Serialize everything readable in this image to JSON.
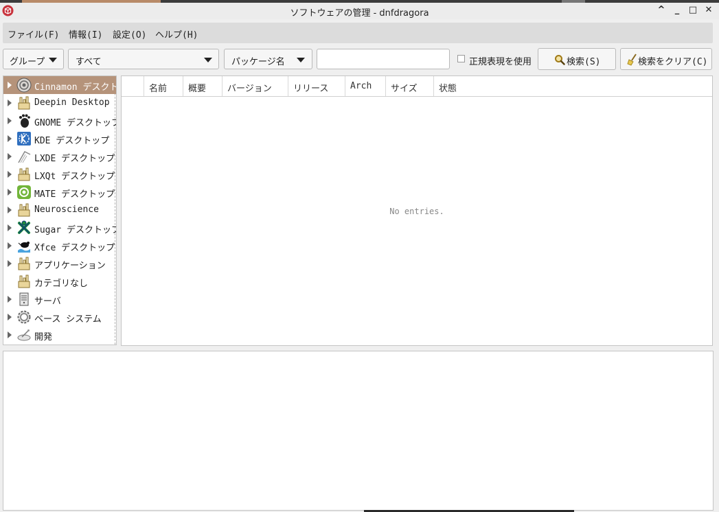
{
  "window": {
    "title": "ソフトウェアの管理 - dnfdragora",
    "buttons": [
      "^",
      "_",
      "□",
      "✕"
    ]
  },
  "menu": {
    "items": [
      "ファイル(F)",
      "情報(I)",
      "設定(O)",
      "ヘルプ(H)"
    ]
  },
  "toolbar": {
    "view_combo": "グループ",
    "filter_combo": "すべて",
    "search_field_combo": "パッケージ名",
    "search_value": "",
    "regex_label": "正規表現を使用",
    "regex_checked": false,
    "search_button": "検索(S)",
    "clear_button": "検索をクリア(C)"
  },
  "groups": [
    {
      "label": "Cinnamon デスクトップ",
      "icon": "cinnamon-icon",
      "expandable": true,
      "selected": true
    },
    {
      "label": "Deepin Desktop",
      "icon": "package-icon",
      "expandable": true
    },
    {
      "label": "GNOME デスクトップ",
      "icon": "gnome-foot-icon",
      "expandable": true
    },
    {
      "label": "KDE デスクトップ",
      "icon": "kde-icon",
      "expandable": true
    },
    {
      "label": "LXDE デスクトップ",
      "icon": "lxde-icon",
      "expandable": true
    },
    {
      "label": "LXQt デスクトップ",
      "icon": "package-icon",
      "expandable": true
    },
    {
      "label": "MATE デスクトップ",
      "icon": "mate-icon",
      "expandable": true
    },
    {
      "label": "Neuroscience",
      "icon": "package-icon",
      "expandable": true
    },
    {
      "label": "Sugar デスクトップ",
      "icon": "sugar-icon",
      "expandable": true
    },
    {
      "label": "Xfce デスクトップ",
      "icon": "xfce-mouse-icon",
      "expandable": true
    },
    {
      "label": "アプリケーション",
      "icon": "package-icon",
      "expandable": true
    },
    {
      "label": "カテゴリなし",
      "icon": "package-icon",
      "expandable": false
    },
    {
      "label": "サーバ",
      "icon": "server-icon",
      "expandable": true
    },
    {
      "label": "ベース システム",
      "icon": "gear-icon",
      "expandable": true
    },
    {
      "label": "開発",
      "icon": "development-icon",
      "expandable": true
    }
  ],
  "packages": {
    "columns": [
      "",
      "名前",
      "概要",
      "バージョン",
      "リリース",
      "Arch",
      "サイズ",
      "状態"
    ],
    "empty_text": "No entries."
  },
  "colors": {
    "selection": "#b5937a",
    "window_bg": "#efefef",
    "app_icon": "#c8323c"
  }
}
